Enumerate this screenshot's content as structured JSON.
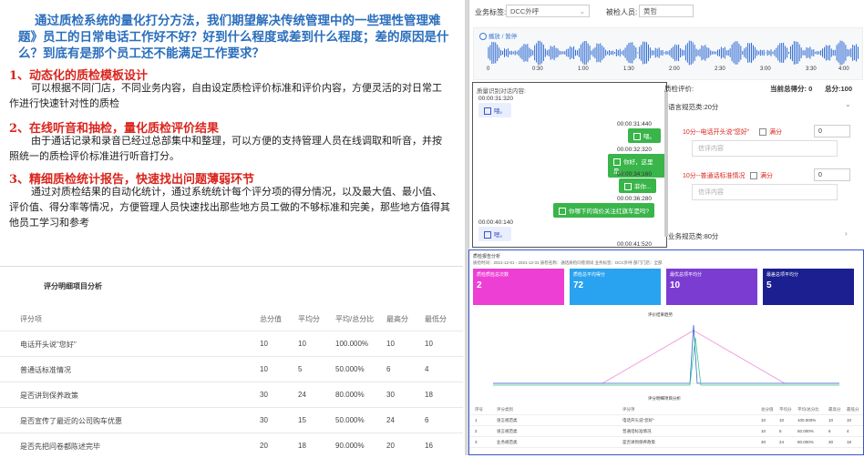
{
  "text_panel": {
    "intro": "通过质检系统的量化打分方法，我们期望解决传统管理中的一些理性管理难题》员工的日常电话工作好不好？好到什么程度或差到什么程度；差的原因是什么？到底有是那个员工还不能满足工作要求？",
    "sections": [
      {
        "heading": "1、动态化的质检模板设计",
        "body": "可以根据不同门店，不同业务内容，自由设定质检评价标准和评价内容，方便灵活的对日常工作进行快速针对性的质检"
      },
      {
        "heading": "2、在线听音和抽检，量化质检评价结果",
        "body": "由于通话记录和录音已经过总部集中和整理，可以方便的支持管理人员在线调取和听音，并按照统一的质检评价标准进行听音打分。"
      },
      {
        "heading": "3、精细质检统计报告，快速找出问题薄弱环节",
        "body": "通过对质检结果的自动化统计，通过系统统计每个评分项的得分情况，以及最大值、最小值、评价值、得分率等情况，方便管理人员快速找出那些地方员工做的不够标准和完美，那些地方值得其他员工学习和参考"
      }
    ]
  },
  "table_panel": {
    "title": "评分明细项目分析",
    "headers": [
      "评分项",
      "总分值",
      "平均分",
      "平均/总分比",
      "最高分",
      "最低分"
    ],
    "rows": [
      [
        "电话开头说\"您好\"",
        "10",
        "10",
        "100.000%",
        "10",
        "10"
      ],
      [
        "普通话标准情况",
        "10",
        "5",
        "50.000%",
        "6",
        "4"
      ],
      [
        "是否讲到保养政策",
        "30",
        "24",
        "80.000%",
        "30",
        "18"
      ],
      [
        "是否宣传了最近的公司购车优惠",
        "30",
        "15",
        "50.000%",
        "24",
        "6"
      ],
      [
        "是否先把问卷都陈述完毕",
        "20",
        "18",
        "90.000%",
        "20",
        "16"
      ]
    ]
  },
  "qa_panel": {
    "tag_label": "业务标签:",
    "tag_value": "DCC外呼",
    "inspected_label": "被检人员:",
    "inspected_value": "黄哲",
    "play_label": "播放 / 暂停",
    "timeline": [
      "0",
      "0:30",
      "1:00",
      "1:30",
      "2:00",
      "2:30",
      "3:00",
      "3:30",
      "4:00"
    ],
    "chat_title": "质量识别对话内容:",
    "chat": [
      {
        "side": "left",
        "time": "00:00:31:320",
        "text": "喂。"
      },
      {
        "side": "right",
        "time": "00:00:31:440",
        "text": "喂。"
      },
      {
        "side": "right",
        "time": "00:00:32:320",
        "text": "你好，这里是。"
      },
      {
        "side": "right",
        "time": "00:00:34:160",
        "text": "菲你..."
      },
      {
        "side": "right",
        "time": "00:00:36:280",
        "text": "你哪下的询价关注红旗车是吗?"
      },
      {
        "side": "left",
        "time": "00:00:40:140",
        "text": "嗯。"
      },
      {
        "side": "right",
        "time": "00:00:41:520",
        "text": ""
      }
    ],
    "eval_label": "质检评价:",
    "current_score_label": "当前总得分: 0",
    "total_score_label": "总分:100",
    "section1": "语言规范类:20分",
    "item1": "10分--电话开头说\"您好\"",
    "item2": "10分--普通话标准情况",
    "full_mark": "满分",
    "score_value": "0",
    "comment_placeholder": "信评内容",
    "section2": "业务规范类:80分"
  },
  "dash_panel": {
    "header": "质检报告分析",
    "filter_text": "质检时间：2021-12-01 - 2021-12-31   质检名称：通话质检问卷测试   业务标签：DCC外呼   部门门店：全部",
    "cards": [
      {
        "title": "质检质检总次数",
        "value": "2",
        "color": "#ee3fd5"
      },
      {
        "title": "质检总平均得分",
        "value": "72",
        "color": "#29a3f0"
      },
      {
        "title": "最优总项平均分",
        "value": "10",
        "color": "#7b3dd1"
      },
      {
        "title": "最差总项平均分",
        "value": "5",
        "color": "#1b1f8f"
      }
    ],
    "chart_title": "评价结果趋势",
    "table_title": "评分明细项目分析",
    "table_headers": [
      "序号",
      "评分类别",
      "评分项",
      "总分值",
      "平均分",
      "平均/总分比",
      "最高分",
      "最低分"
    ],
    "table_rows": [
      [
        "1",
        "语言规范类",
        "电话开头说\"您好\"",
        "10",
        "10",
        "100.000%",
        "10",
        "10"
      ],
      [
        "2",
        "语言规范类",
        "普通话标准情况",
        "10",
        "5",
        "50.000%",
        "6",
        "4"
      ],
      [
        "3",
        "业务规范类",
        "是否讲到保养政策",
        "30",
        "24",
        "80.000%",
        "30",
        "18"
      ]
    ]
  }
}
